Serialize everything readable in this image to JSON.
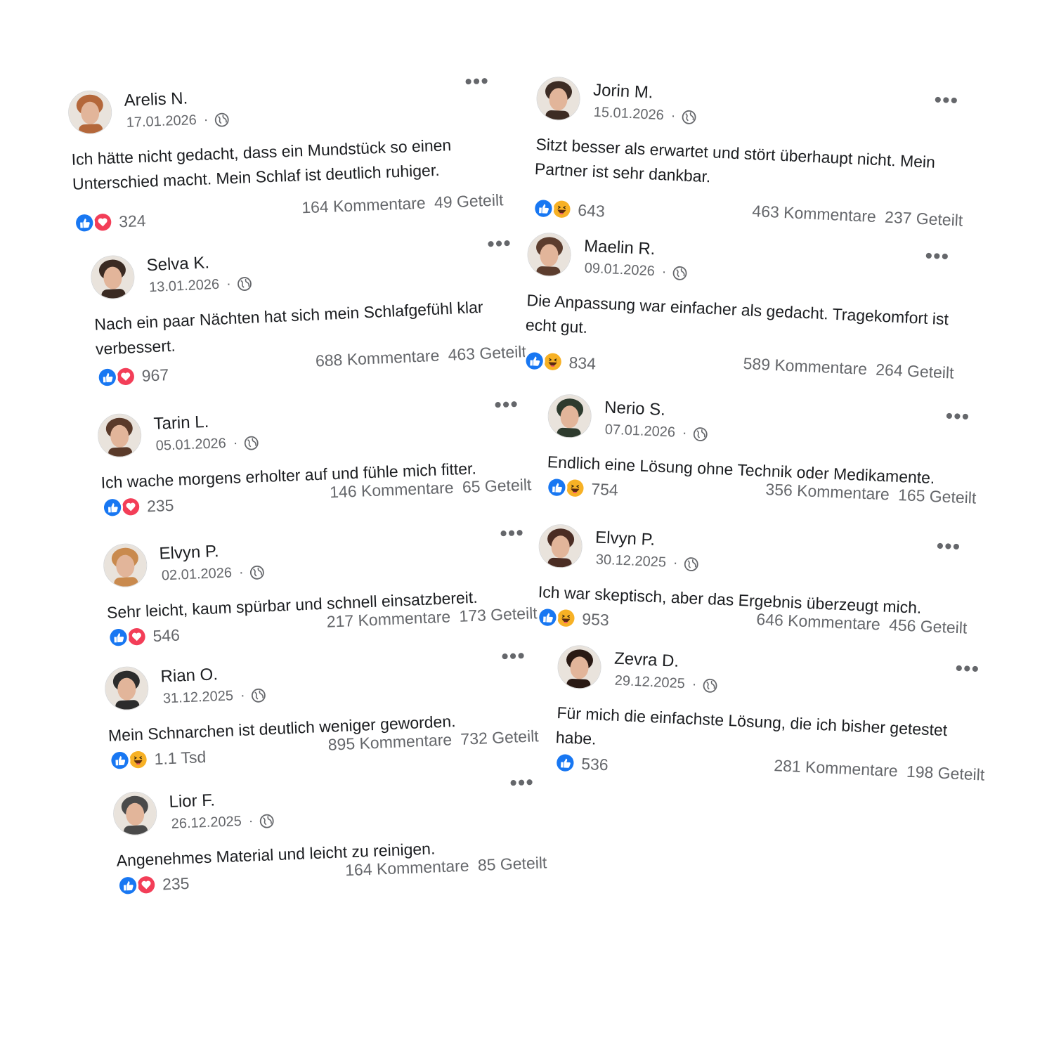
{
  "posts": [
    {
      "name": "Arelis N.",
      "date": "17.01.2026",
      "text": "Ich hätte nicht gedacht, dass ein Mundstück so einen Unterschied macht. Mein Schlaf ist deutlich ruhiger.",
      "reactions": [
        "like",
        "love"
      ],
      "reaction_count": "324",
      "comments": "164 Kommentare",
      "shares": "49 Geteilt",
      "avatar_color": "#b4673a"
    },
    {
      "name": "Selva K.",
      "date": "13.01.2026",
      "text": "Nach ein paar Nächten hat sich mein Schlafgefühl klar verbessert.",
      "reactions": [
        "like",
        "love"
      ],
      "reaction_count": "967",
      "comments": "688 Kommentare",
      "shares": "463 Geteilt",
      "avatar_color": "#3a2a22"
    },
    {
      "name": "Tarin L.",
      "date": "05.01.2026",
      "text": "Ich wache morgens erholter auf und fühle mich fitter.",
      "reactions": [
        "like",
        "love"
      ],
      "reaction_count": "235",
      "comments": "146 Kommentare",
      "shares": "65 Geteilt",
      "avatar_color": "#5a3a2a"
    },
    {
      "name": "Elvyn P.",
      "date": "02.01.2026",
      "text": "Sehr leicht, kaum spürbar und schnell einsatzbereit.",
      "reactions": [
        "like",
        "love"
      ],
      "reaction_count": "546",
      "comments": "217 Kommentare",
      "shares": "173 Geteilt",
      "avatar_color": "#c98a4e"
    },
    {
      "name": "Rian O.",
      "date": "31.12.2025",
      "text": "Mein Schnarchen ist deutlich weniger geworden.",
      "reactions": [
        "like",
        "haha"
      ],
      "reaction_count": "1.1 Tsd",
      "comments": "895 Kommentare",
      "shares": "732 Geteilt",
      "avatar_color": "#2c2c2c"
    },
    {
      "name": "Lior F.",
      "date": "26.12.2025",
      "text": "Angenehmes Material und leicht zu reinigen.",
      "reactions": [
        "like",
        "love"
      ],
      "reaction_count": "235",
      "comments": "164 Kommentare",
      "shares": "85 Geteilt",
      "avatar_color": "#4a4a4a"
    },
    {
      "name": "Jorin M.",
      "date": "15.01.2026",
      "text": "Sitzt besser als erwartet und stört überhaupt nicht. Mein Partner ist sehr dankbar.",
      "reactions": [
        "like",
        "haha"
      ],
      "reaction_count": "643",
      "comments": "463 Kommentare",
      "shares": "237 Geteilt",
      "avatar_color": "#3d2c24"
    },
    {
      "name": "Maelin R.",
      "date": "09.01.2026",
      "text": "Die Anpassung war einfacher als gedacht. Tragekomfort ist echt gut.",
      "reactions": [
        "like",
        "haha"
      ],
      "reaction_count": "834",
      "comments": "589 Kommentare",
      "shares": "264 Geteilt",
      "avatar_color": "#5c3d2e"
    },
    {
      "name": "Nerio S.",
      "date": "07.01.2026",
      "text": "Endlich eine Lösung ohne Technik oder Medikamente.",
      "reactions": [
        "like",
        "haha"
      ],
      "reaction_count": "754",
      "comments": "356 Kommentare",
      "shares": "165 Geteilt",
      "avatar_color": "#2e3b2e"
    },
    {
      "name": "Elvyn P.",
      "date": "30.12.2025",
      "text": "Ich war skeptisch, aber das Ergebnis überzeugt mich.",
      "reactions": [
        "like",
        "haha"
      ],
      "reaction_count": "953",
      "comments": "646 Kommentare",
      "shares": "456 Geteilt",
      "avatar_color": "#4b2d24"
    },
    {
      "name": "Zevra D.",
      "date": "29.12.2025",
      "text": "Für mich die einfachste Lösung, die ich bisher getestet habe.",
      "reactions": [
        "like"
      ],
      "reaction_count": "536",
      "comments": "281 Kommentare",
      "shares": "198 Geteilt",
      "avatar_color": "#2a1a14"
    }
  ],
  "more_label": "•••",
  "meta_separator": "·",
  "colors": {
    "like": "#1877f2",
    "love": "#f33e58",
    "haha": "#f7b125",
    "secondary_text": "#65676b"
  },
  "icons": {
    "more": "more-options-icon",
    "globe": "globe-icon",
    "like": "like-reaction-icon",
    "love": "love-reaction-icon",
    "haha": "haha-reaction-icon"
  }
}
